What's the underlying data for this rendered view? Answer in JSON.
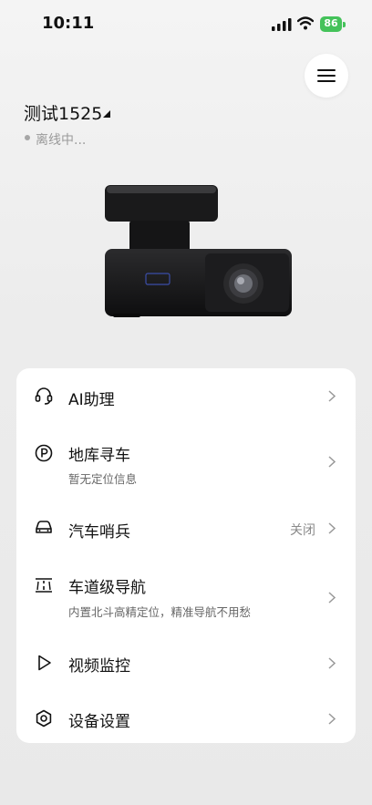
{
  "status_bar": {
    "time": "10:11",
    "battery": "86"
  },
  "device": {
    "name": "测试1525",
    "status": "离线中..."
  },
  "menu": [
    {
      "id": "ai",
      "icon": "headset-icon",
      "title": "AI助理",
      "subtitle": "",
      "value": ""
    },
    {
      "id": "parking",
      "icon": "parking-icon",
      "title": "地库寻车",
      "subtitle": "暂无定位信息",
      "value": ""
    },
    {
      "id": "sentry",
      "icon": "car-icon",
      "title": "汽车哨兵",
      "subtitle": "",
      "value": "关闭"
    },
    {
      "id": "lane",
      "icon": "lane-navigation-icon",
      "title": "车道级导航",
      "subtitle": "内置北斗高精定位，精准导航不用愁",
      "value": ""
    },
    {
      "id": "video",
      "icon": "play-icon",
      "title": "视频监控",
      "subtitle": "",
      "value": ""
    },
    {
      "id": "settings",
      "icon": "gear-icon",
      "title": "设备设置",
      "subtitle": "",
      "value": ""
    }
  ],
  "colors": {
    "battery": "#44c25a",
    "card": "#ffffff",
    "muted_text": "#9a9a9a"
  }
}
